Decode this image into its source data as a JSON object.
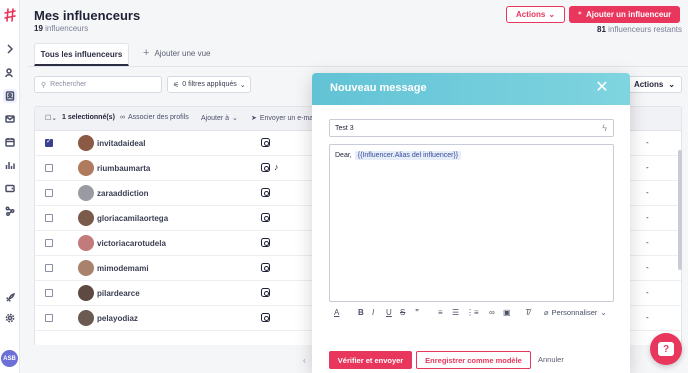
{
  "header": {
    "title": "Mes influenceurs",
    "count_number": "19",
    "count_label": "influenceurs",
    "actions_label": "Actions",
    "add_label": "Ajouter un influenceur",
    "remaining_number": "81",
    "remaining_label": "influenceurs restants"
  },
  "tabs": {
    "all_label": "Tous les influenceurs",
    "add_view_label": "Ajouter une vue"
  },
  "filters": {
    "search_placeholder": "Rechercher",
    "filters_label": "0 filtres appliqués",
    "actions_label": "Actions"
  },
  "table_header": {
    "selected_label": "1 selectionné(s)",
    "associate_label": "Associer des profils",
    "add_to_label": "Ajouter à",
    "send_label": "Envoyer un e-mail"
  },
  "rows": [
    {
      "name": "invitadaideal",
      "checked": true,
      "tiktok": false,
      "avatar_color": "#8a5a44"
    },
    {
      "name": "riumbaumarta",
      "checked": false,
      "tiktok": true,
      "avatar_color": "#b07a5e"
    },
    {
      "name": "zaraaddiction",
      "checked": false,
      "tiktok": false,
      "avatar_color": "#9a9aa3"
    },
    {
      "name": "gloriacamilaortega",
      "checked": false,
      "tiktok": false,
      "avatar_color": "#7a5a4a"
    },
    {
      "name": "victoriacarotudela",
      "checked": false,
      "tiktok": false,
      "avatar_color": "#c27a7a"
    },
    {
      "name": "mimodemami",
      "checked": false,
      "tiktok": false,
      "avatar_color": "#a8826a"
    },
    {
      "name": "pilardearce",
      "checked": false,
      "tiktok": false,
      "avatar_color": "#5e4a42"
    },
    {
      "name": "pelayodiaz",
      "checked": false,
      "tiktok": false,
      "avatar_color": "#6a5a52"
    }
  ],
  "row_value": "-",
  "modal": {
    "title": "Nouveau message",
    "subject_value": "Test 3",
    "body_prefix": "Dear,",
    "body_variable": "{{Influencer.Alias del influencer}}",
    "personalize_label": "Personnaliser",
    "verify_label": "Vérifier et envoyer",
    "save_template_label": "Enregistrer comme modèle",
    "cancel_label": "Annuler"
  },
  "sidebar": {
    "avatar_initials": "ASB"
  },
  "colors": {
    "brand": "#e8365d",
    "modal_header": "#62c3d6"
  }
}
